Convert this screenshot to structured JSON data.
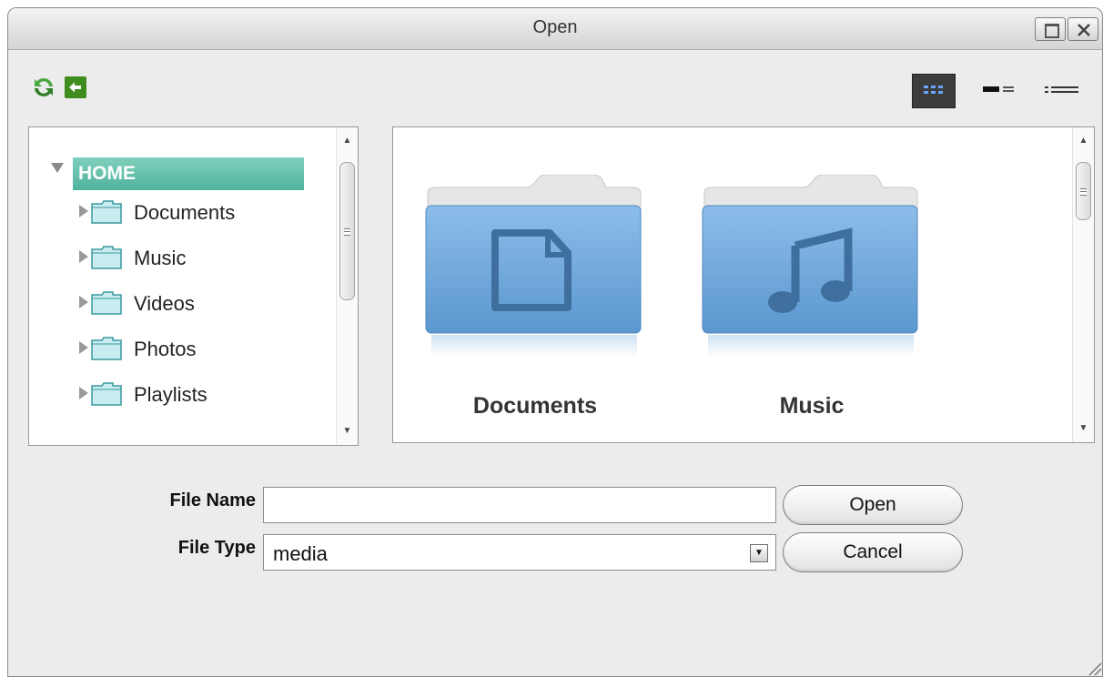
{
  "window": {
    "title": "Open",
    "controls": [
      "maximize-icon",
      "close-icon"
    ]
  },
  "toolbar": {
    "actions": [
      "refresh-icon",
      "back-icon"
    ],
    "views": [
      "icons-view-icon",
      "detail-view-icon",
      "list-view-icon"
    ],
    "active_view": "icons-view-icon"
  },
  "tree": {
    "root": "HOME",
    "items": [
      {
        "label": "Documents"
      },
      {
        "label": "Music"
      },
      {
        "label": "Videos"
      },
      {
        "label": "Photos"
      },
      {
        "label": "Playlists"
      }
    ]
  },
  "browser": {
    "folders": [
      {
        "label": "Documents",
        "icon": "document-icon"
      },
      {
        "label": "Music",
        "icon": "music-note-icon"
      }
    ]
  },
  "form": {
    "file_name_label": "File Name",
    "file_name_value": "",
    "file_type_label": "File Type",
    "file_type_value": "media",
    "open_label": "Open",
    "cancel_label": "Cancel"
  },
  "colors": {
    "selection": "#5bbba4",
    "folder_blue": "#6aa6dc",
    "active_view_bg": "#3c3c3c",
    "action_green": "#3f8d1f"
  }
}
